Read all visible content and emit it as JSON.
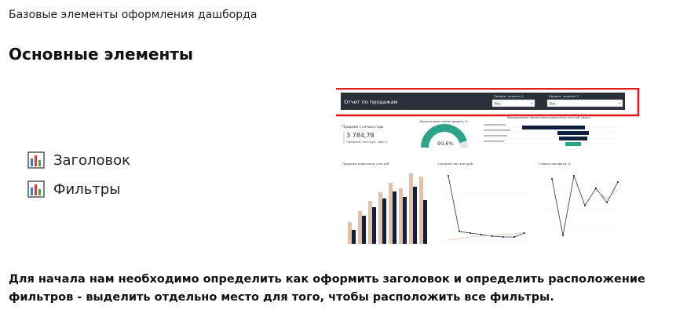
{
  "page": {
    "title": "Базовые элементы оформления дашборда",
    "section_title": "Основные элементы",
    "bullets": [
      "Заголовок",
      "Фильтры"
    ],
    "description": "Для начала нам необходимо определить как оформить заголовок и определить расположение фильтров - выделить отдельно место для того, чтобы расположить все фильтры."
  },
  "dashboard": {
    "header_title": "Отчет по продажам",
    "filter1_label": "Продукт уровень 1",
    "filter1_value": "Все",
    "filter2_label": "Продукт уровень 2",
    "filter2_value": "Все",
    "kpi_label": "Продажи с начала года",
    "kpi_value": "3 784,78",
    "kpi_sub": "Продажи, млн руб. (факт)",
    "gauge_label": "Выполнение плана продаж, %",
    "gauge_value": "90,6%",
    "gauge_fraction": 0.906,
    "funnel_label": "Формирование финансового результата, млн руб. (факт)",
    "chart1_title": "Продажи помесячно, млн руб.",
    "chart2_title": "Средний чек, млн руб.",
    "chart3_title": "Ставка портфеля, %",
    "colors": {
      "header_bg": "#2b2f3a",
      "highlight": "#e31b1b",
      "gauge": "#2aa58a",
      "bar_a": "#e2c1a8",
      "bar_b": "#0f1f3d",
      "line": "#2b3342",
      "accent_line": "#e7a27f"
    }
  }
}
